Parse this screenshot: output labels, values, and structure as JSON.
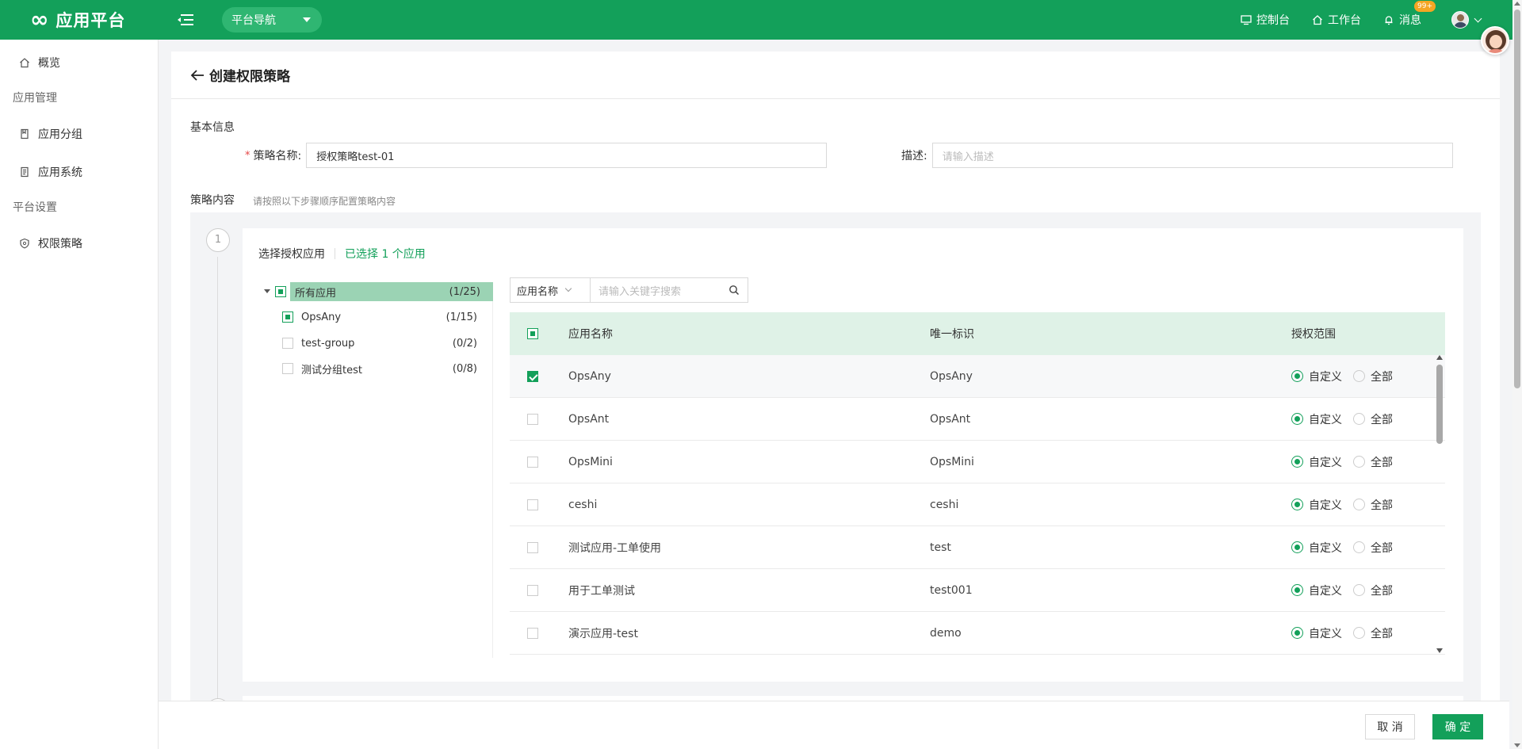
{
  "colors": {
    "brand": "#13a05a",
    "header_row": "#dff2e7",
    "selected_tree": "#9bd3b4"
  },
  "topbar": {
    "logo_symbol": "∞",
    "app_name": "应用平台",
    "nav_label": "平台导航",
    "links": [
      {
        "label": "控制台",
        "icon": "monitor-icon"
      },
      {
        "label": "工作台",
        "icon": "home-icon"
      },
      {
        "label": "消息",
        "icon": "bell-icon",
        "badge": "99+"
      }
    ]
  },
  "sidebar": {
    "overview": "概览",
    "group_app": "应用管理",
    "app_group": "应用分组",
    "app_system": "应用系统",
    "group_platform": "平台设置",
    "permission_policy": "权限策略"
  },
  "page": {
    "title": "创建权限策略",
    "basic_info": "基本信息",
    "name_label": "策略名称:",
    "name_value": "授权策略test-01",
    "desc_label": "描述:",
    "desc_placeholder": "请输入描述",
    "content_label": "策略内容",
    "content_hint": "请按照以下步骤顺序配置策略内容"
  },
  "step1": {
    "number": "1",
    "title": "选择授权应用",
    "selected_text": "已选择 1 个应用",
    "tree": [
      {
        "label": "所有应用",
        "count": "(1/25)",
        "state": "partial",
        "level": 0
      },
      {
        "label": "OpsAny",
        "count": "(1/15)",
        "state": "partial",
        "level": 1
      },
      {
        "label": "test-group",
        "count": "(0/2)",
        "state": "none",
        "level": 1
      },
      {
        "label": "测试分组test",
        "count": "(0/8)",
        "state": "none",
        "level": 1
      }
    ],
    "search_field": "应用名称",
    "search_placeholder": "请输入关键字搜索",
    "columns": [
      "应用名称",
      "唯一标识",
      "授权范围"
    ],
    "radio_custom": "自定义",
    "radio_all": "全部",
    "rows": [
      {
        "name": "OpsAny",
        "id": "OpsAny",
        "checked": true
      },
      {
        "name": "OpsAnt",
        "id": "OpsAnt",
        "checked": false
      },
      {
        "name": "OpsMini",
        "id": "OpsMini",
        "checked": false
      },
      {
        "name": "ceshi",
        "id": "ceshi",
        "checked": false
      },
      {
        "name": "测试应用-工单使用",
        "id": "test",
        "checked": false
      },
      {
        "name": "用于工单测试",
        "id": "test001",
        "checked": false
      },
      {
        "name": "演示应用-test",
        "id": "demo",
        "checked": false
      }
    ]
  },
  "footer": {
    "cancel": "取 消",
    "confirm": "确 定"
  }
}
